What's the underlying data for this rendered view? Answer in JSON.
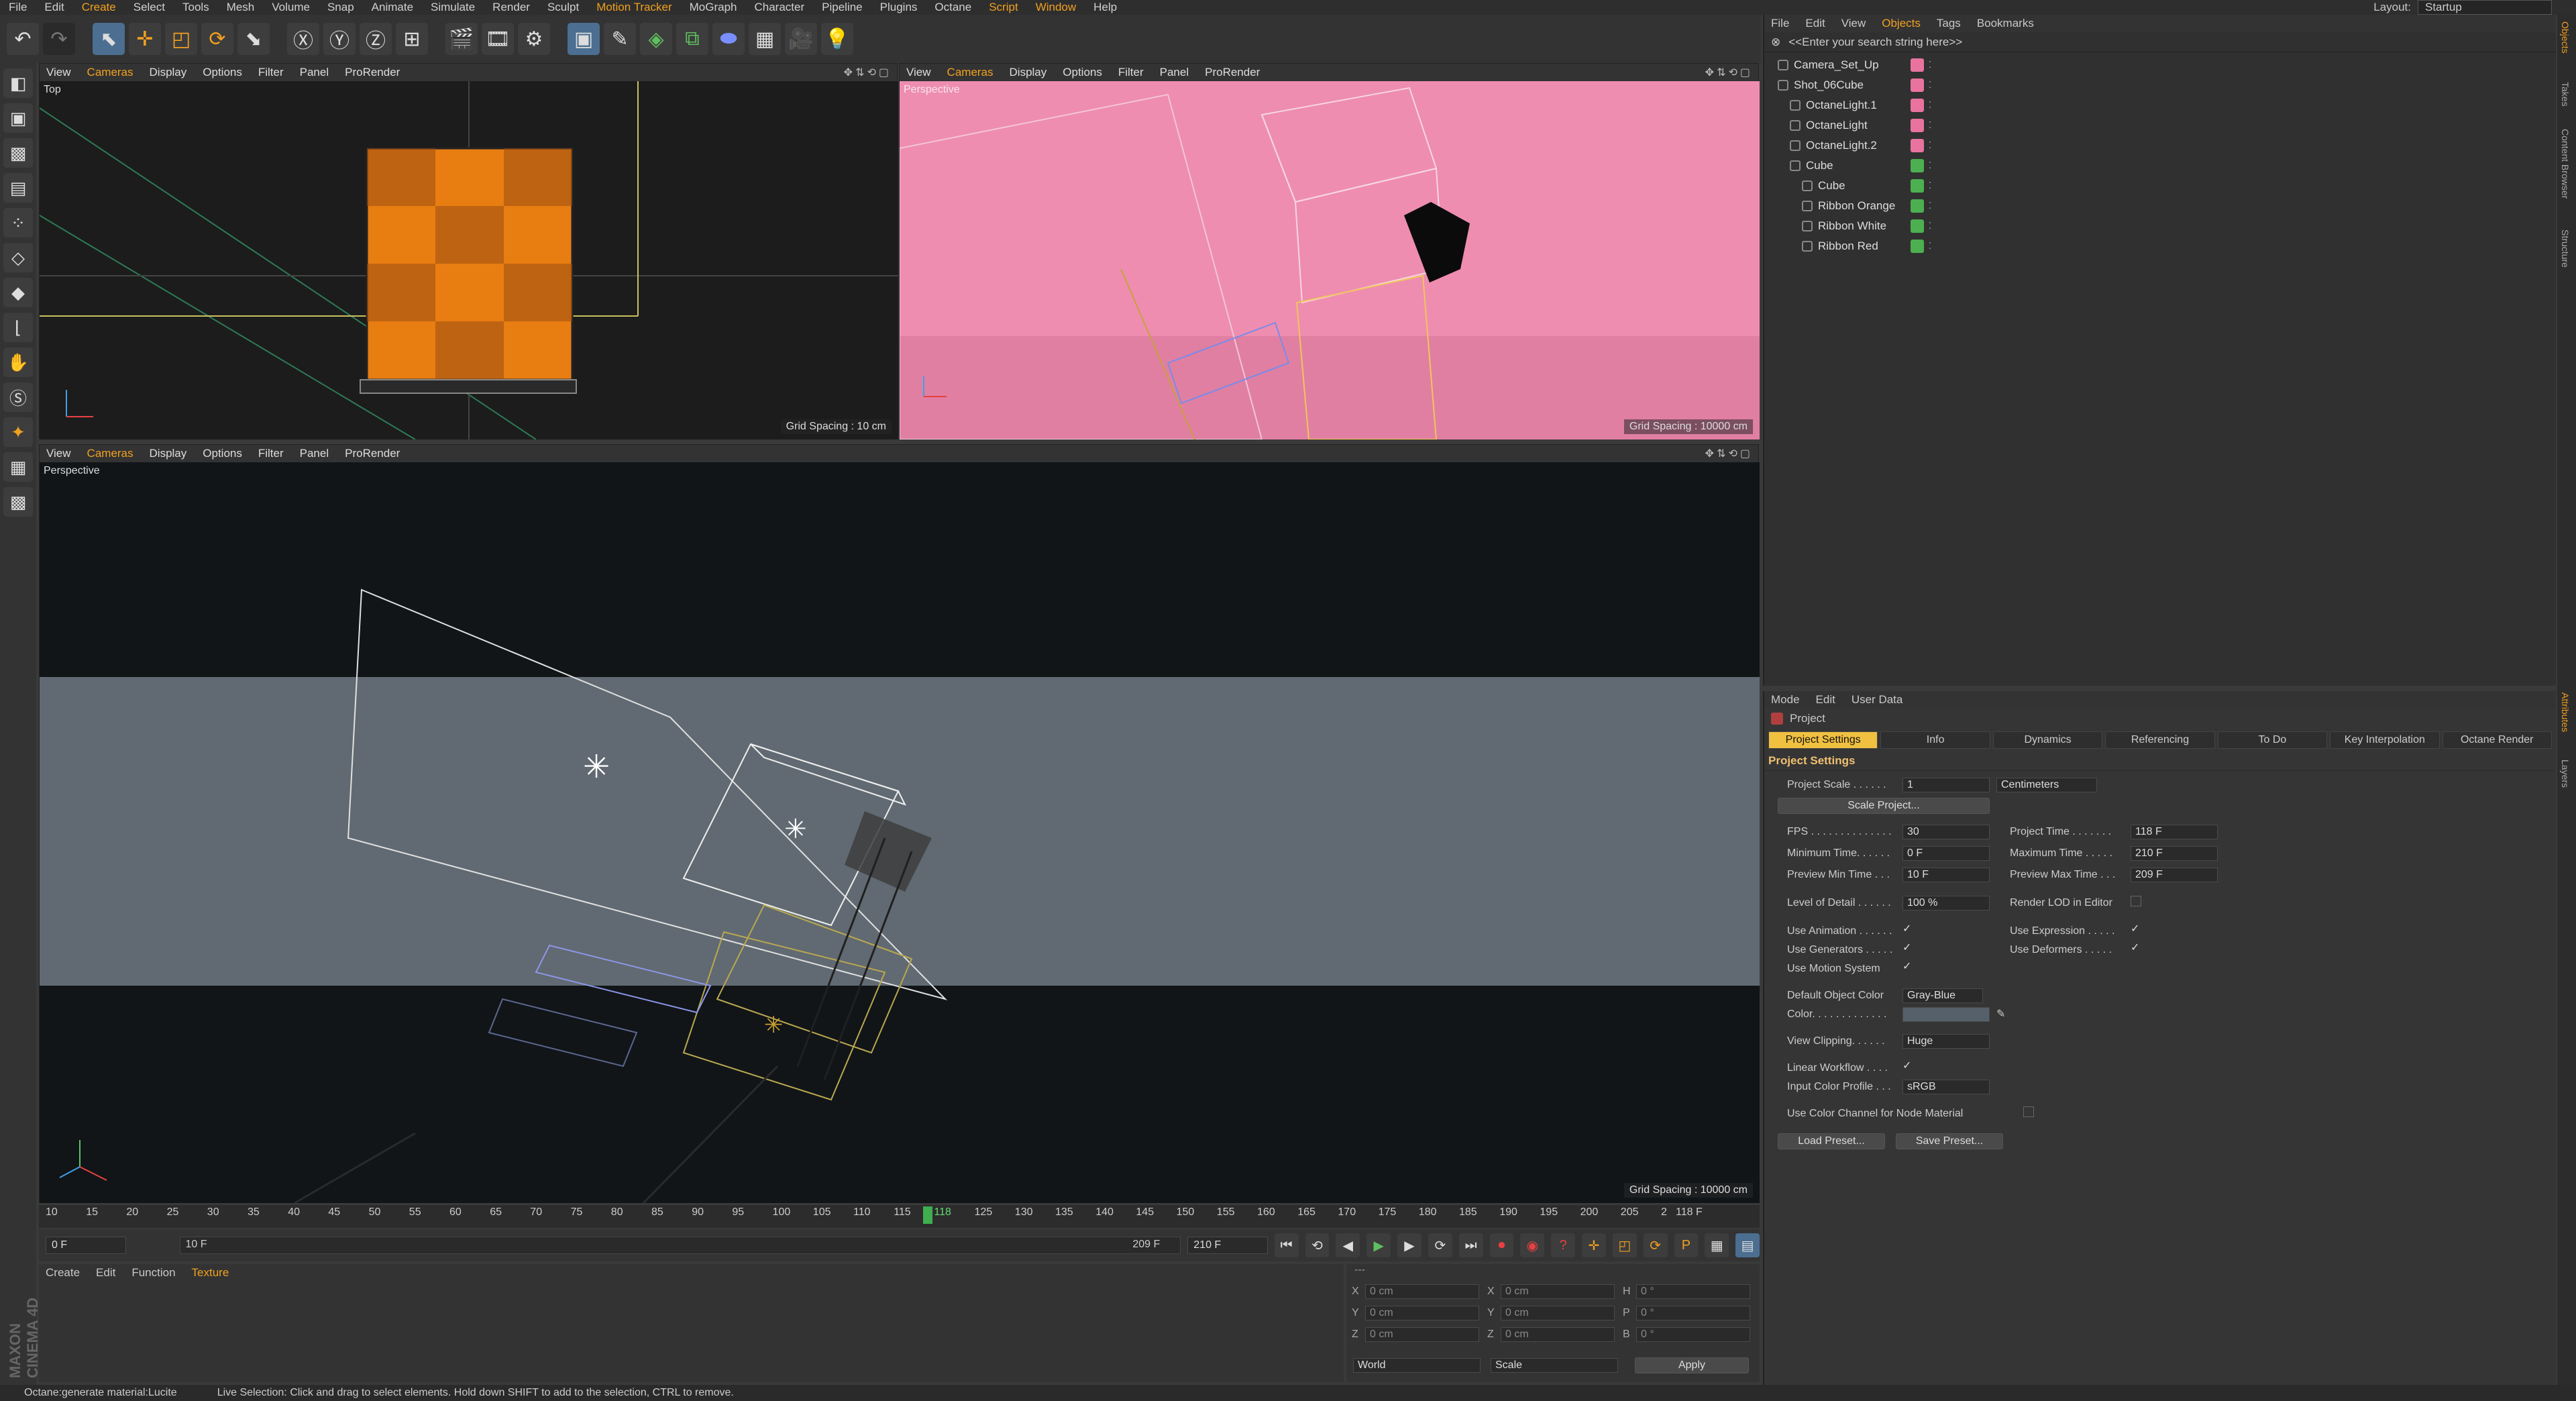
{
  "menubar": {
    "items": [
      "File",
      "Edit",
      "Create",
      "Select",
      "Tools",
      "Mesh",
      "Volume",
      "Snap",
      "Animate",
      "Simulate",
      "Render",
      "Sculpt",
      "Motion Tracker",
      "MoGraph",
      "Character",
      "Pipeline",
      "Plugins",
      "Octane",
      "Script",
      "Window",
      "Help"
    ],
    "layout_label": "Layout:",
    "layout_value": "Startup"
  },
  "viewport_menu": [
    "View",
    "Cameras",
    "Display",
    "Options",
    "Filter",
    "Panel",
    "ProRender"
  ],
  "viewports": {
    "top": {
      "name": "Top",
      "grid": "Grid Spacing : 10 cm"
    },
    "persp_small": {
      "name": "Perspective",
      "grid": "Grid Spacing : 10000 cm"
    },
    "persp_main": {
      "name": "Perspective",
      "grid": "Grid Spacing : 10000 cm"
    }
  },
  "objects": {
    "menu": [
      "File",
      "Edit",
      "View",
      "Objects",
      "Tags",
      "Bookmarks"
    ],
    "search_placeholder": "<<Enter your search string here>>",
    "rows": [
      {
        "label": "Camera_Set_Up",
        "indent": 0,
        "tag": "#e8739f"
      },
      {
        "label": "Shot_06Cube",
        "indent": 0,
        "tag": "#e8739f"
      },
      {
        "label": "OctaneLight.1",
        "indent": 1,
        "tag": "#e8739f"
      },
      {
        "label": "OctaneLight",
        "indent": 1,
        "tag": "#e8739f"
      },
      {
        "label": "OctaneLight.2",
        "indent": 1,
        "tag": "#e8739f"
      },
      {
        "label": "Cube",
        "indent": 1,
        "tag": "#4caf50"
      },
      {
        "label": "Cube",
        "indent": 2,
        "tag": "#4caf50"
      },
      {
        "label": "Ribbon Orange",
        "indent": 2,
        "tag": "#4caf50"
      },
      {
        "label": "Ribbon White",
        "indent": 2,
        "tag": "#4caf50"
      },
      {
        "label": "Ribbon Red",
        "indent": 2,
        "tag": "#4caf50"
      }
    ]
  },
  "attributes": {
    "menu": [
      "Mode",
      "Edit",
      "User Data"
    ],
    "object": "Project",
    "tabs": [
      "Project Settings",
      "Info",
      "Dynamics",
      "Referencing",
      "To Do",
      "Key Interpolation",
      "Octane Render"
    ],
    "section": "Project Settings",
    "project_scale_label": "Project Scale . . . . . .",
    "project_scale": "1",
    "scale_unit": "Centimeters",
    "scale_project_btn": "Scale Project...",
    "fps_label": "FPS . . . . . . . . . . . . . .",
    "fps": "30",
    "project_time_label": "Project Time . . . . . . .",
    "project_time": "118 F",
    "min_time_label": "Minimum Time. . . . . .",
    "min_time": "0 F",
    "max_time_label": "Maximum Time . . . . .",
    "max_time": "210 F",
    "prev_min_label": "Preview Min Time . . .",
    "prev_min": "10 F",
    "prev_max_label": "Preview Max Time . . .",
    "prev_max": "209 F",
    "lod_label": "Level of Detail . . . . . .",
    "lod": "100 %",
    "render_lod_label": "Render LOD in Editor",
    "use_animation_label": "Use Animation . . . . . .",
    "use_expression_label": "Use Expression . . . . .",
    "use_generators_label": "Use Generators . . . . .",
    "use_deformers_label": "Use Deformers . . . . .",
    "use_motion_label": "Use Motion System",
    "def_color_label": "Default Object Color",
    "def_color": "Gray-Blue",
    "color_label": "Color. . . . . . . . . . . . .",
    "view_clipping_label": "View Clipping. . . . . .",
    "view_clipping": "Huge",
    "linear_label": "Linear Workflow . . . .",
    "input_profile_label": "Input Color Profile . . .",
    "input_profile": "sRGB",
    "use_color_channel_label": "Use Color Channel for Node Material",
    "load_preset": "Load Preset...",
    "save_preset": "Save Preset..."
  },
  "right_tabs": [
    "Objects",
    "Takes",
    "Content Browser",
    "Structure",
    "Attributes",
    "Layers"
  ],
  "timeline": {
    "ticks": [
      "10",
      "15",
      "20",
      "25",
      "30",
      "35",
      "40",
      "45",
      "50",
      "55",
      "60",
      "65",
      "70",
      "75",
      "80",
      "85",
      "90",
      "95",
      "100",
      "105",
      "110",
      "115",
      "118",
      "125",
      "130",
      "135",
      "140",
      "145",
      "150",
      "155",
      "160",
      "165",
      "170",
      "175",
      "180",
      "185",
      "190",
      "195",
      "200",
      "205",
      "2"
    ],
    "current_frame": 118,
    "current_frame_label": "118 F",
    "start_field": "0 F",
    "range_start": "10 F",
    "range_end": "209 F",
    "end_field": "210 F"
  },
  "material": {
    "menu": [
      "Create",
      "Edit",
      "Function",
      "Texture"
    ]
  },
  "coords": {
    "rows": [
      {
        "a": "X",
        "av": "0 cm",
        "b": "X",
        "bv": "0 cm",
        "c": "H",
        "cv": "0 °"
      },
      {
        "a": "Y",
        "av": "0 cm",
        "b": "Y",
        "bv": "0 cm",
        "c": "P",
        "cv": "0 °"
      },
      {
        "a": "Z",
        "av": "0 cm",
        "b": "Z",
        "bv": "0 cm",
        "c": "B",
        "cv": "0 °"
      }
    ],
    "space": "World",
    "mode": "Scale",
    "apply": "Apply"
  },
  "brand": "MAXON CINEMA 4D",
  "status": {
    "left": "Octane:generate material:Lucite",
    "message": "Live Selection: Click and drag to select elements. Hold down SHIFT to add to the selection, CTRL to remove."
  },
  "colors": {
    "accent": "#f0a020",
    "pink_bg": "#ee8db0",
    "playhead": "#3fae4f"
  }
}
